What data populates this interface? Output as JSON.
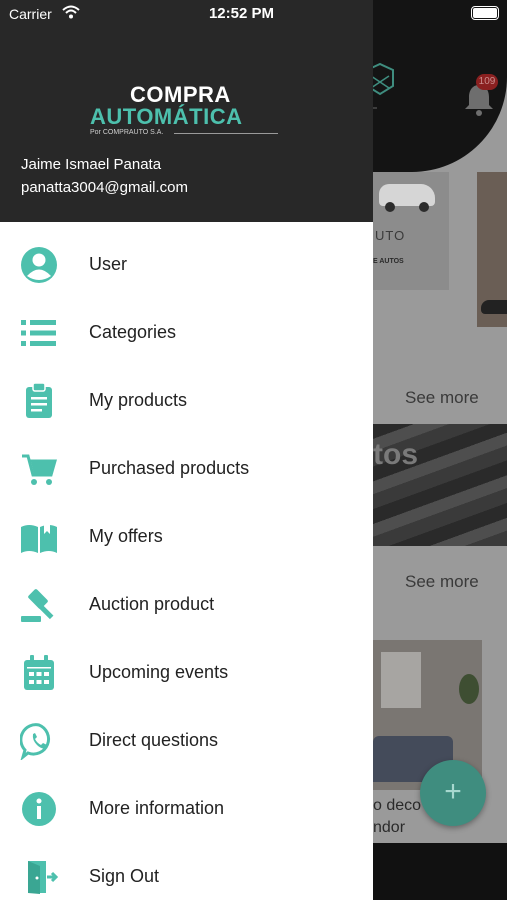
{
  "status_bar": {
    "carrier": "Carrier",
    "time": "12:52 PM"
  },
  "drawer": {
    "logo": {
      "line1": "COMPRA",
      "line2": "AUTOMÁTICA",
      "line3": "Por COMPRAUTO S.A."
    },
    "user": {
      "name": "Jaime Ismael Panata",
      "email": "panatta3004@gmail.com"
    },
    "accent_color": "#4dc0ad",
    "items": [
      {
        "label": "User",
        "icon": "user-icon"
      },
      {
        "label": "Categories",
        "icon": "list-icon"
      },
      {
        "label": "My products",
        "icon": "clipboard-icon"
      },
      {
        "label": "Purchased products",
        "icon": "cart-icon"
      },
      {
        "label": "My offers",
        "icon": "book-icon"
      },
      {
        "label": "Auction product",
        "icon": "gavel-icon"
      },
      {
        "label": "Upcoming events",
        "icon": "calendar-icon"
      },
      {
        "label": "Direct questions",
        "icon": "whatsapp-icon"
      },
      {
        "label": "More information",
        "icon": "info-icon"
      },
      {
        "label": "Sign Out",
        "icon": "exit-icon"
      }
    ]
  },
  "background": {
    "notification_count": "109",
    "card_caption_1": "UTO",
    "card_caption_2": "E AUTOS",
    "see_more_1": "See more",
    "see_more_2": "See more",
    "banner_text": "tos",
    "product_caption_line1": "o deco",
    "product_caption_line2": "ndor",
    "fab_symbol": "+"
  }
}
